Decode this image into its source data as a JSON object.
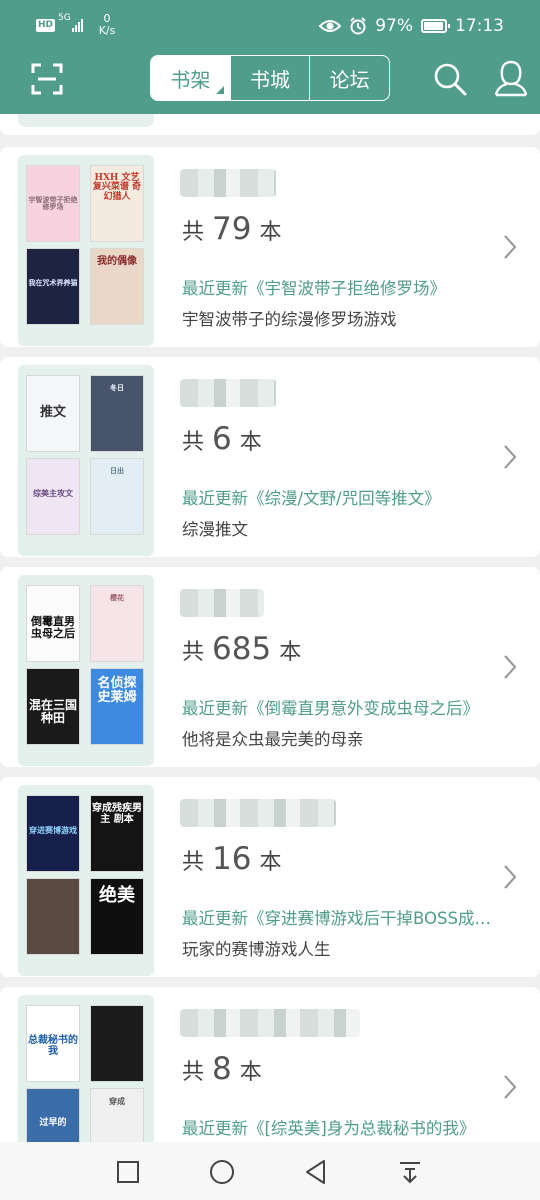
{
  "status_bar": {
    "hd": "HD",
    "network": "5G",
    "speed_value": "0",
    "speed_unit": "K/s",
    "battery": "97%",
    "battery_level": 0.97,
    "time": "17:13"
  },
  "nav": {
    "tabs": [
      {
        "label": "书架",
        "active": true
      },
      {
        "label": "书城",
        "active": false
      },
      {
        "label": "论坛",
        "active": false
      }
    ],
    "icons": [
      "scan-icon",
      "search-icon",
      "user-icon"
    ]
  },
  "booklists": [
    {
      "count_prefix": "共",
      "count": "79",
      "count_suffix": "本",
      "latest": "最近更新《宇智波带子拒绝修罗场》",
      "desc": "宇智波带子的综漫修罗场游戏",
      "covers": [
        {
          "text": "宇智波带子拒绝修罗场",
          "bg": "#f6d3df",
          "fg": "#8a6b78"
        },
        {
          "text": "HXH 文艺复兴菜谱 奇幻猎人",
          "bg": "#f3ebe0",
          "fg": "#c0392b"
        },
        {
          "text": "我在咒术界养猫",
          "bg": "#1d2340",
          "fg": "#dfe6ff"
        },
        {
          "text": "我的偶像",
          "bg": "#e9d7c8",
          "fg": "#8a2c2c"
        }
      ]
    },
    {
      "count_prefix": "共",
      "count": "6",
      "count_suffix": "本",
      "latest": "最近更新《综漫/文野/咒回等推文》",
      "desc": "综漫推文",
      "covers": [
        {
          "text": "推文",
          "bg": "#f5f6fa",
          "fg": "#333333"
        },
        {
          "text": "冬日",
          "bg": "#46536b",
          "fg": "#f0f4ff"
        },
        {
          "text": "综美主攻文",
          "bg": "#efe6f4",
          "fg": "#6b4d80"
        },
        {
          "text": "日出",
          "bg": "#e2eef4",
          "fg": "#5f7a8c"
        }
      ]
    },
    {
      "count_prefix": "共",
      "count": "685",
      "count_suffix": "本",
      "latest": "最近更新《倒霉直男意外变成虫母之后》",
      "desc": "他将是众虫最完美的母亲",
      "covers": [
        {
          "text": "倒霉直男 虫母之后",
          "bg": "#fbfbfb",
          "fg": "#111111"
        },
        {
          "text": "樱花",
          "bg": "#f7e4e8",
          "fg": "#a0606e"
        },
        {
          "text": "混在三国 种田",
          "bg": "#1a1a1a",
          "fg": "#ffffff"
        },
        {
          "text": "名侦探 史莱姆",
          "bg": "#3d8be0",
          "fg": "#ffffff"
        }
      ]
    },
    {
      "count_prefix": "共",
      "count": "16",
      "count_suffix": "本",
      "latest": "最近更新《穿进赛博游戏后干掉BOSS成功上位》",
      "desc": "玩家的赛博游戏人生",
      "covers": [
        {
          "text": "穿进赛博游戏",
          "bg": "#16204a",
          "fg": "#8fd4ff"
        },
        {
          "text": "穿成残疾男主 剧本",
          "bg": "#141414",
          "fg": "#ffffff"
        },
        {
          "text": "",
          "bg": "#5a4a42",
          "fg": "#ffffff"
        },
        {
          "text": "绝美",
          "bg": "#0f0f0f",
          "fg": "#ffffff"
        }
      ]
    },
    {
      "count_prefix": "共",
      "count": "8",
      "count_suffix": "本",
      "latest": "最近更新《[综英美]身为总裁秘书的我》",
      "desc": "",
      "covers": [
        {
          "text": "总裁秘书的我",
          "bg": "#ffffff",
          "fg": "#1f5fa8"
        },
        {
          "text": "",
          "bg": "#1c1c1c",
          "fg": "#ffffff"
        },
        {
          "text": "过早的",
          "bg": "#3b6ea8",
          "fg": "#ffffff"
        },
        {
          "text": "穿成",
          "bg": "#f0f0f0",
          "fg": "#555555"
        }
      ]
    }
  ],
  "colors": {
    "brand": "#4f9d8a",
    "background": "#f0f0f0",
    "card": "#ffffff",
    "cover_frame": "#e3f0ec"
  },
  "system_nav": {
    "icons": [
      "recent-apps-icon",
      "home-icon",
      "back-icon",
      "notification-pull-icon"
    ]
  }
}
